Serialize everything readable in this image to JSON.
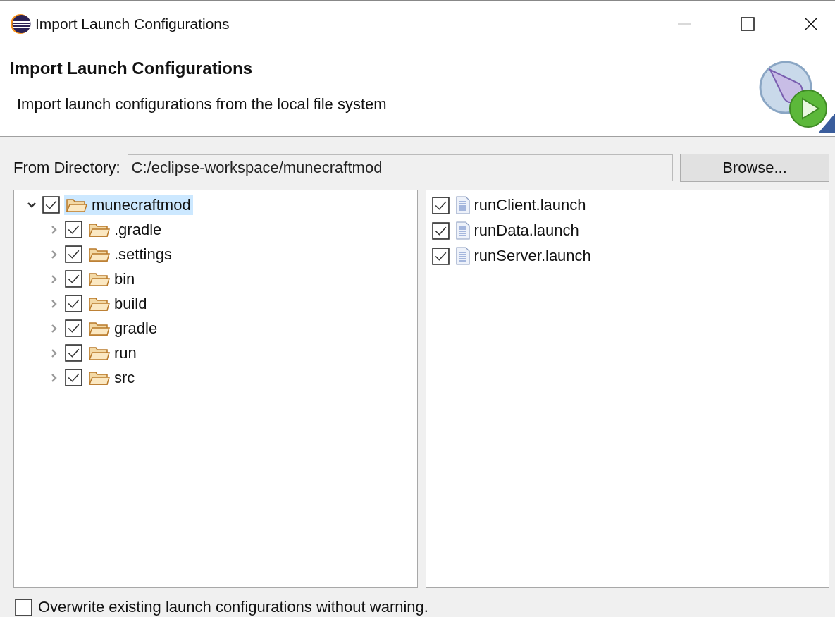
{
  "window": {
    "title": "Import Launch Configurations"
  },
  "header": {
    "title": "Import Launch Configurations",
    "description": "Import launch configurations from the local file system"
  },
  "directory": {
    "label": "From Directory:",
    "value": "C:/eclipse-workspace/munecraftmod",
    "button": "Browse..."
  },
  "tree": [
    {
      "label": "munecraftmod",
      "checked": true,
      "expanded": true,
      "selected": true,
      "children": [
        {
          "label": ".gradle",
          "checked": true,
          "expanded": false,
          "selected": false
        },
        {
          "label": ".settings",
          "checked": true,
          "expanded": false,
          "selected": false
        },
        {
          "label": "bin",
          "checked": true,
          "expanded": false,
          "selected": false
        },
        {
          "label": "build",
          "checked": true,
          "expanded": false,
          "selected": false
        },
        {
          "label": "gradle",
          "checked": true,
          "expanded": false,
          "selected": false
        },
        {
          "label": "run",
          "checked": true,
          "expanded": false,
          "selected": false
        },
        {
          "label": "src",
          "checked": true,
          "expanded": false,
          "selected": false
        }
      ]
    }
  ],
  "files": [
    {
      "label": "runClient.launch",
      "checked": true
    },
    {
      "label": "runData.launch",
      "checked": true
    },
    {
      "label": "runServer.launch",
      "checked": true
    }
  ],
  "overwrite": {
    "label": "Overwrite existing launch configurations without warning.",
    "checked": false
  }
}
